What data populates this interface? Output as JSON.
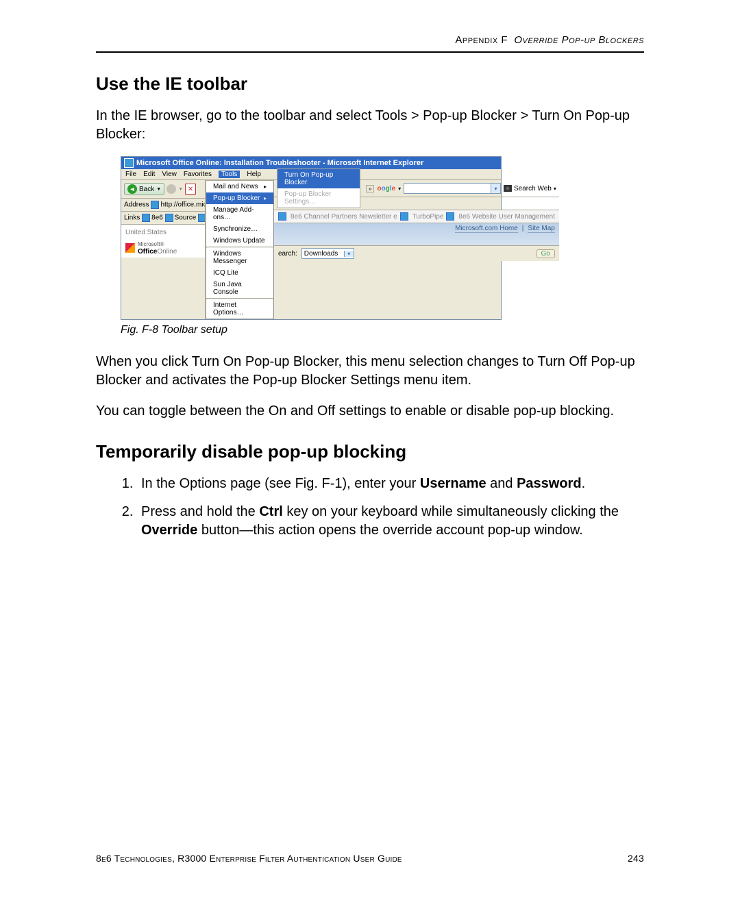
{
  "header": {
    "left": "Appendix F",
    "right": "Override Pop-up Blockers"
  },
  "section1": {
    "title": "Use the IE toolbar",
    "p1": "In the IE browser, go to the toolbar and select Tools > Pop-up Blocker > Turn On Pop-up Blocker:",
    "caption": "Fig. F-8  Toolbar setup",
    "p2": "When you click Turn On Pop-up Blocker, this menu selection changes to Turn Off Pop-up Blocker and activates the Pop-up Blocker Settings menu item.",
    "p3": "You can toggle between the On and Off settings to enable or disable pop-up blocking."
  },
  "section2": {
    "title": "Temporarily disable pop-up blocking",
    "step1a": "In the Options page (see Fig. F-1), enter your ",
    "step1_user": "Username",
    "step1b": " and ",
    "step1_pass": "Password",
    "step1c": ".",
    "step2a": "Press and hold the ",
    "step2_ctrl": "Ctrl",
    "step2b": " key on your keyboard while simultaneously clicking the ",
    "step2_override": "Override",
    "step2c": " button—this action opens the override account pop-up window."
  },
  "footer": {
    "text": "8e6 Technologies, R3000 Enterprise Filter Authentication User Guide",
    "page": "243"
  },
  "ie": {
    "title": "Microsoft Office Online: Installation Troubleshooter - Microsoft Internet Explorer",
    "menu": {
      "file": "File",
      "edit": "Edit",
      "view": "View",
      "favorites": "Favorites",
      "tools": "Tools",
      "help": "Help"
    },
    "toolbar": {
      "back": "Back"
    },
    "address_label": "Address",
    "address_value": "http://office.microso",
    "links_label": "Links",
    "links": {
      "a": "8e6",
      "b": "Source"
    },
    "us": "United States",
    "office_ms": "Microsoft®",
    "office": "Office",
    "online": "Online",
    "tools_menu": {
      "mail": "Mail and News",
      "popup": "Pop-up Blocker",
      "addons": "Manage Add-ons…",
      "sync": "Synchronize…",
      "wu": "Windows Update",
      "wm": "Windows Messenger",
      "icq": "ICQ Lite",
      "java": "Sun Java Console",
      "opts": "Internet Options…"
    },
    "submenu": {
      "turn_on": "Turn On Pop-up Blocker",
      "settings": "Pop-up Blocker Settings…"
    },
    "google": "oogle",
    "search_web": "Search Web",
    "links2": {
      "a": "8e6 Channel Partners Newsletter  e",
      "b": "TurboPipe",
      "c": "8e6 Website User Management"
    },
    "ms_home": "Microsoft.com Home",
    "sitemap": "Site Map",
    "search": "earch:",
    "downloads": "Downloads",
    "go": "Go"
  }
}
